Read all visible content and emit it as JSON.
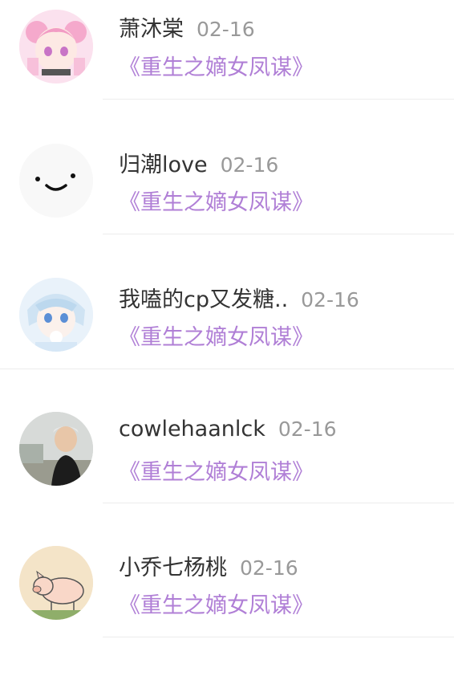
{
  "accent_color": "#b07fd6",
  "items": [
    {
      "name": "萧沐棠",
      "date": "02-16",
      "book": "《重生之嫡女凤谋》",
      "avatar_icon": "anime-girl-pink-avatar"
    },
    {
      "name": "归潮love",
      "date": "02-16",
      "book": "《重生之嫡女凤谋》",
      "avatar_icon": "smiley-face-avatar"
    },
    {
      "name": "我嗑的cp又发糖..",
      "date": "02-16",
      "book": "《重生之嫡女凤谋》",
      "avatar_icon": "anime-character-blue-avatar"
    },
    {
      "name": "cowlehaanlck",
      "date": "02-16",
      "book": "《重生之嫡女凤谋》",
      "avatar_icon": "man-photo-avatar"
    },
    {
      "name": "小乔七杨桃",
      "date": "02-16",
      "book": "《重生之嫡女凤谋》",
      "avatar_icon": "pig-drawing-avatar"
    }
  ]
}
